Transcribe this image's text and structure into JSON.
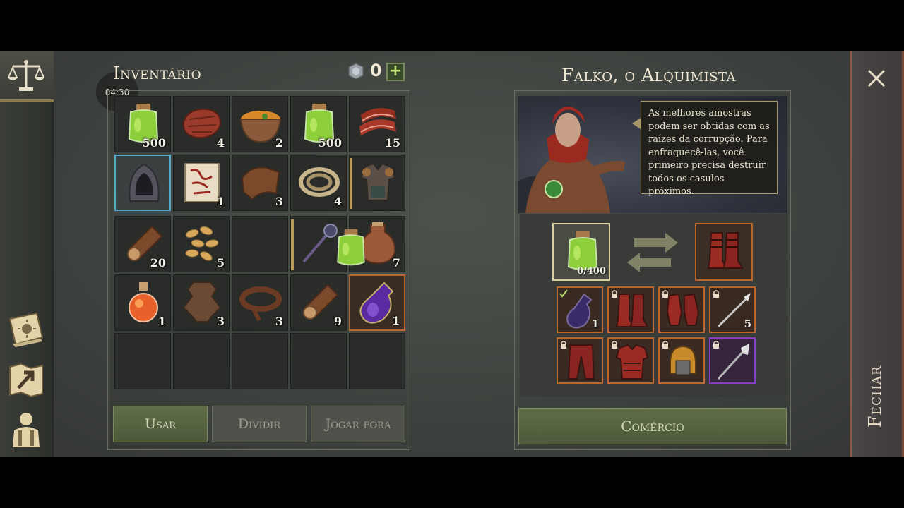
{
  "timer": "04:30",
  "inventory": {
    "title": "Inventário",
    "coins": "0",
    "add_label": "+",
    "rows": [
      [
        {
          "name": "green-potion-icon",
          "qty": "500"
        },
        {
          "name": "raw-meat-icon",
          "qty": "4"
        },
        {
          "name": "soup-bowl-icon",
          "qty": "2"
        },
        {
          "name": "green-potion-icon",
          "qty": "500"
        },
        {
          "name": "bacon-icon",
          "qty": "15"
        }
      ],
      [
        {
          "name": "hood-icon",
          "qty": ""
        },
        {
          "name": "scroll-map-icon",
          "qty": "1"
        },
        {
          "name": "leather-scrap-icon",
          "qty": "3"
        },
        {
          "name": "rope-icon",
          "qty": "4"
        },
        {
          "name": "armor-icon",
          "qty": ""
        }
      ],
      [
        {
          "name": "log-icon",
          "qty": "20"
        },
        {
          "name": "seeds-icon",
          "qty": "5"
        },
        {
          "name": "empty-slot",
          "qty": ""
        },
        {
          "name": "mace-icon",
          "qty": ""
        },
        {
          "name": "flask-icon",
          "qty": "7"
        }
      ],
      [
        {
          "name": "fire-potion-icon",
          "qty": "1"
        },
        {
          "name": "hide-icon",
          "qty": "3"
        },
        {
          "name": "leather-strip-icon",
          "qty": "3"
        },
        {
          "name": "log-icon",
          "qty": "9"
        },
        {
          "name": "purple-potion-icon",
          "qty": "1"
        }
      ]
    ],
    "buttons": {
      "use": "Usar",
      "split": "Dividir",
      "drop": "Jogar fora"
    }
  },
  "trader": {
    "title": "Falko, o Alquimista",
    "speech": "As melhores amostras podem ser obtidas com as raízes da corrupção. Para enfraquecê-las, você primeiro precisa destruir todos os casulos próximos.",
    "offer_qty": "0/400",
    "items_row1": [
      {
        "name": "potion-bottle-icon",
        "qty": "1",
        "locked": false
      },
      {
        "name": "boots-icon",
        "qty": "",
        "locked": true
      },
      {
        "name": "gloves-icon",
        "qty": "",
        "locked": true
      },
      {
        "name": "spear-icon",
        "qty": "5",
        "locked": true
      }
    ],
    "items_row2": [
      {
        "name": "pants-icon",
        "qty": "",
        "locked": true
      },
      {
        "name": "chest-armor-icon",
        "qty": "",
        "locked": true
      },
      {
        "name": "helmet-icon",
        "qty": "",
        "locked": true
      },
      {
        "name": "halberd-icon",
        "qty": "",
        "locked": true
      }
    ],
    "trade_label": "Comércio"
  },
  "close_label": "Fechar",
  "colors": {
    "accent_green": "#5f6e48",
    "slot_orange": "#b8672e",
    "slot_purple": "#8a3fc0",
    "slot_blue": "#57a9c9"
  }
}
